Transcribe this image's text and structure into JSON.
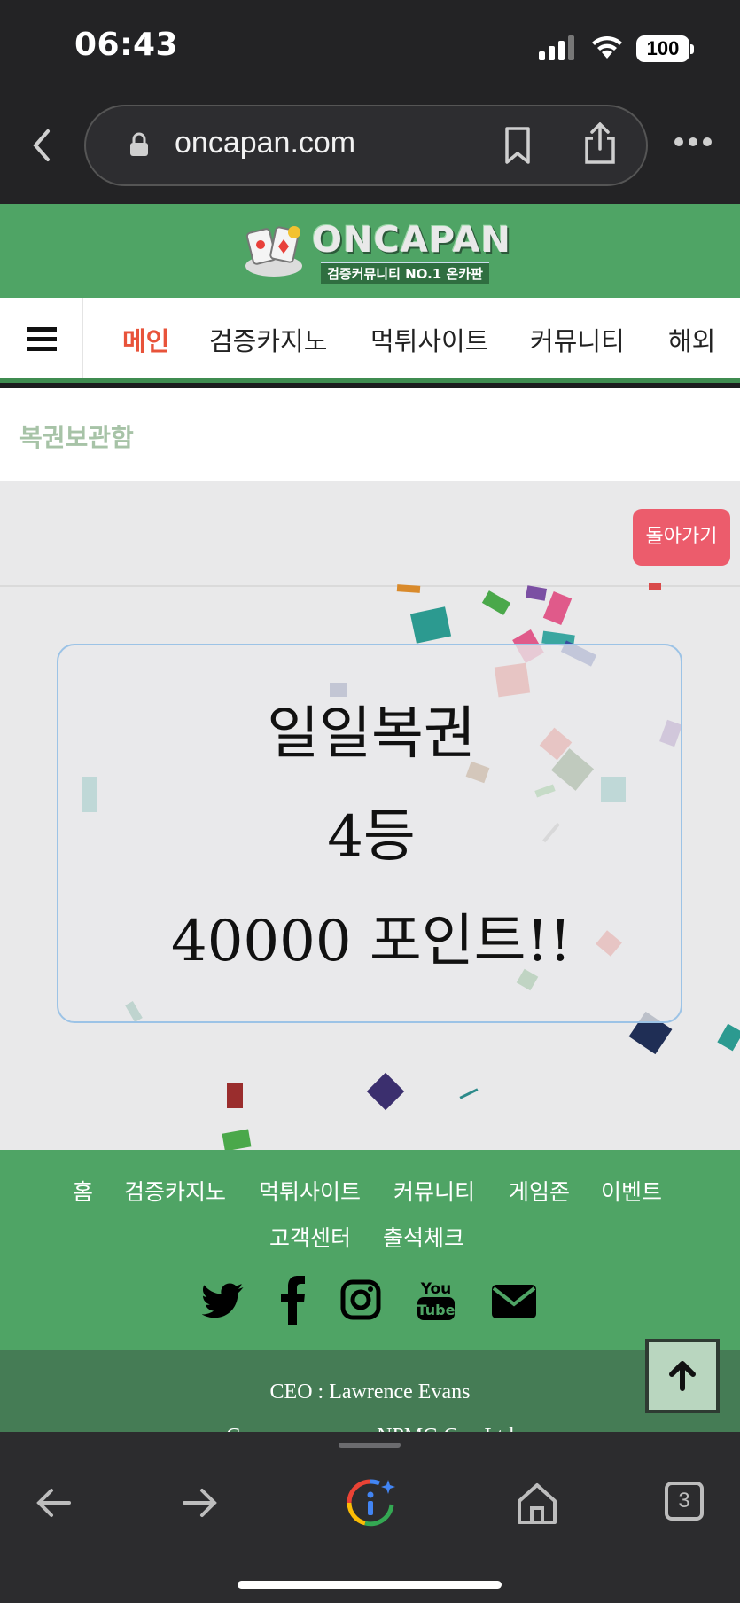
{
  "status_bar": {
    "time": "06:43",
    "battery": "100"
  },
  "browser": {
    "url": "oncapan.com",
    "tab_count": "3"
  },
  "site": {
    "logo_title": "ONCAPAN",
    "logo_subtitle": "검증커뮤니티 NO.1 온카판",
    "nav": [
      "메인",
      "검증카지노",
      "먹튀사이트",
      "커뮤니티",
      "해외"
    ],
    "page_title": "복권보관함"
  },
  "content": {
    "back_button": "돌아가기",
    "prize": {
      "name": "일일복권",
      "rank": "4등",
      "reward": "40000 포인트!!"
    }
  },
  "footer": {
    "links": [
      "홈",
      "검증카지노",
      "먹튀사이트",
      "커뮤니티",
      "게임존",
      "이벤트",
      "고객센터",
      "출석체크"
    ],
    "social": [
      "twitter-icon",
      "facebook-icon",
      "instagram-icon",
      "youtube-icon",
      "envelope-icon"
    ],
    "ceo": "CEO : Lawrence Evans",
    "company": "Company name : NPMG Co., Ltd"
  },
  "colors": {
    "brand_green": "#4fa465",
    "nav_active": "#e8533a",
    "back_button": "#ec5c6c"
  }
}
